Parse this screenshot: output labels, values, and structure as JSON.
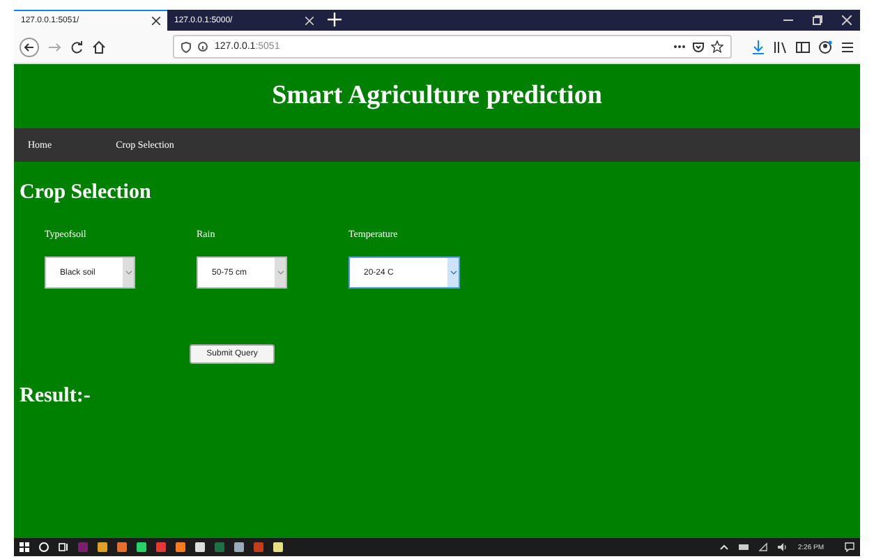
{
  "browser": {
    "tabs": [
      {
        "title": "127.0.0.1:5051/",
        "selected": true
      },
      {
        "title": "127.0.0.1:5000/",
        "selected": false
      }
    ],
    "url_host": "127.0.0.1",
    "url_port": ":5051"
  },
  "page": {
    "title": "Smart Agriculture prediction",
    "nav": [
      {
        "label": "Home"
      },
      {
        "label": "Crop Selection"
      }
    ],
    "heading": "Crop Selection",
    "fields": [
      {
        "label": "Typeofsoil",
        "value": "Black soil",
        "focused": false
      },
      {
        "label": "Rain",
        "value": "50-75 cm",
        "focused": false
      },
      {
        "label": "Temperature",
        "value": "20-24 C",
        "focused": true
      }
    ],
    "submit": "Submit Query",
    "result": "Result:-"
  },
  "taskbar": {
    "clock": "2:26 PM"
  }
}
